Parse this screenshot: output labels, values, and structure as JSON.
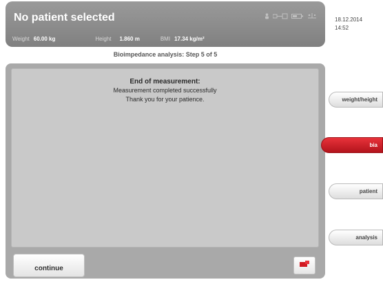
{
  "header": {
    "title": "No patient selected",
    "weight_label": "Weight",
    "weight_value": "60.00 kg",
    "height_label": "Height",
    "height_value": "1.860 m",
    "bmi_label": "BMI",
    "bmi_value": "17.34 kg/m²",
    "status_icons": [
      "user-icon",
      "network-icon",
      "battery-icon",
      "usb-icon"
    ]
  },
  "datetime": {
    "date": "18.12.2014",
    "time": "14:52"
  },
  "step_title": "Bioimpedance analysis: Step 5 of 5",
  "message": {
    "heading": "End of measurement:",
    "line1": "Measurement completed successfully",
    "line2": "Thank you for your patience."
  },
  "buttons": {
    "continue": "continue"
  },
  "sidebar": {
    "items": [
      {
        "label": "weight/height",
        "active": false
      },
      {
        "label": "bia",
        "active": true
      },
      {
        "label": "patient",
        "active": false
      },
      {
        "label": "analysis",
        "active": false
      }
    ]
  },
  "colors": {
    "accent": "#c8141c",
    "panel": "#a9a9a9",
    "header": "#8c8c8c"
  }
}
